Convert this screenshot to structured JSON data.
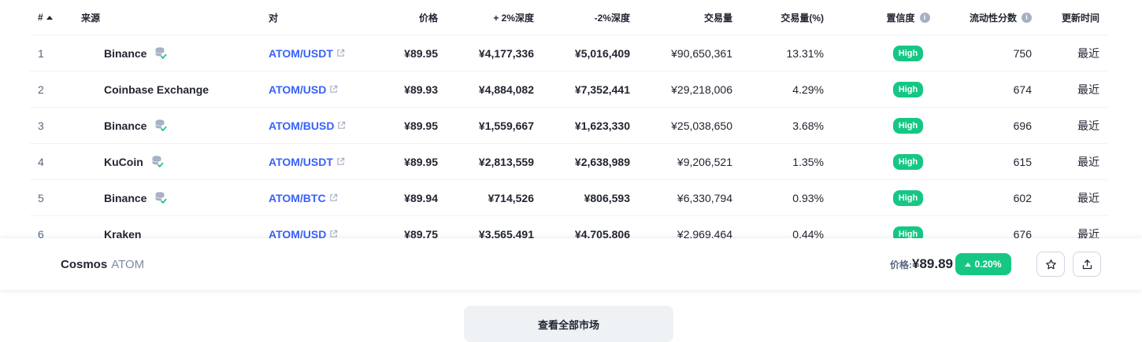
{
  "table": {
    "headers": {
      "num": "#",
      "source": "来源",
      "pair": "对",
      "price": "价格",
      "plus_depth": "+ 2%深度",
      "minus_depth": "-2%深度",
      "volume": "交易量",
      "volume_pct": "交易量(%)",
      "confidence": "置信度",
      "liquidity": "流动性分数",
      "updated": "更新时间"
    },
    "rows": [
      {
        "num": "1",
        "source": "Binance",
        "pair": "ATOM/USDT",
        "price": "¥89.95",
        "plus_depth": "¥4,177,336",
        "minus_depth": "¥5,016,409",
        "volume": "¥90,650,361",
        "volume_pct": "13.31%",
        "confidence": "High",
        "liquidity": "750",
        "updated": "最近"
      },
      {
        "num": "2",
        "source": "Coinbase Exchange",
        "pair": "ATOM/USD",
        "price": "¥89.93",
        "plus_depth": "¥4,884,082",
        "minus_depth": "¥7,352,441",
        "volume": "¥29,218,006",
        "volume_pct": "4.29%",
        "confidence": "High",
        "liquidity": "674",
        "updated": "最近"
      },
      {
        "num": "3",
        "source": "Binance",
        "pair": "ATOM/BUSD",
        "price": "¥89.95",
        "plus_depth": "¥1,559,667",
        "minus_depth": "¥1,623,330",
        "volume": "¥25,038,650",
        "volume_pct": "3.68%",
        "confidence": "High",
        "liquidity": "696",
        "updated": "最近"
      },
      {
        "num": "4",
        "source": "KuCoin",
        "pair": "ATOM/USDT",
        "price": "¥89.95",
        "plus_depth": "¥2,813,559",
        "minus_depth": "¥2,638,989",
        "volume": "¥9,206,521",
        "volume_pct": "1.35%",
        "confidence": "High",
        "liquidity": "615",
        "updated": "最近"
      },
      {
        "num": "5",
        "source": "Binance",
        "pair": "ATOM/BTC",
        "price": "¥89.94",
        "plus_depth": "¥714,526",
        "minus_depth": "¥806,593",
        "volume": "¥6,330,794",
        "volume_pct": "0.93%",
        "confidence": "High",
        "liquidity": "602",
        "updated": "最近"
      },
      {
        "num": "6",
        "source": "Kraken",
        "pair": "ATOM/USD",
        "price": "¥89.75",
        "plus_depth": "¥3,565,491",
        "minus_depth": "¥4,705,806",
        "volume": "¥2,969,464",
        "volume_pct": "0.44%",
        "confidence": "High",
        "liquidity": "676",
        "updated": "最近"
      }
    ]
  },
  "sticky_bar": {
    "coin_name": "Cosmos",
    "coin_symbol": "ATOM",
    "price_label": "价格:",
    "price": "¥89.89",
    "change": "0.20%"
  },
  "view_all_label": "查看全部市场",
  "colors": {
    "accent": "#3861fb",
    "positive": "#16c784",
    "muted": "#58667e"
  }
}
